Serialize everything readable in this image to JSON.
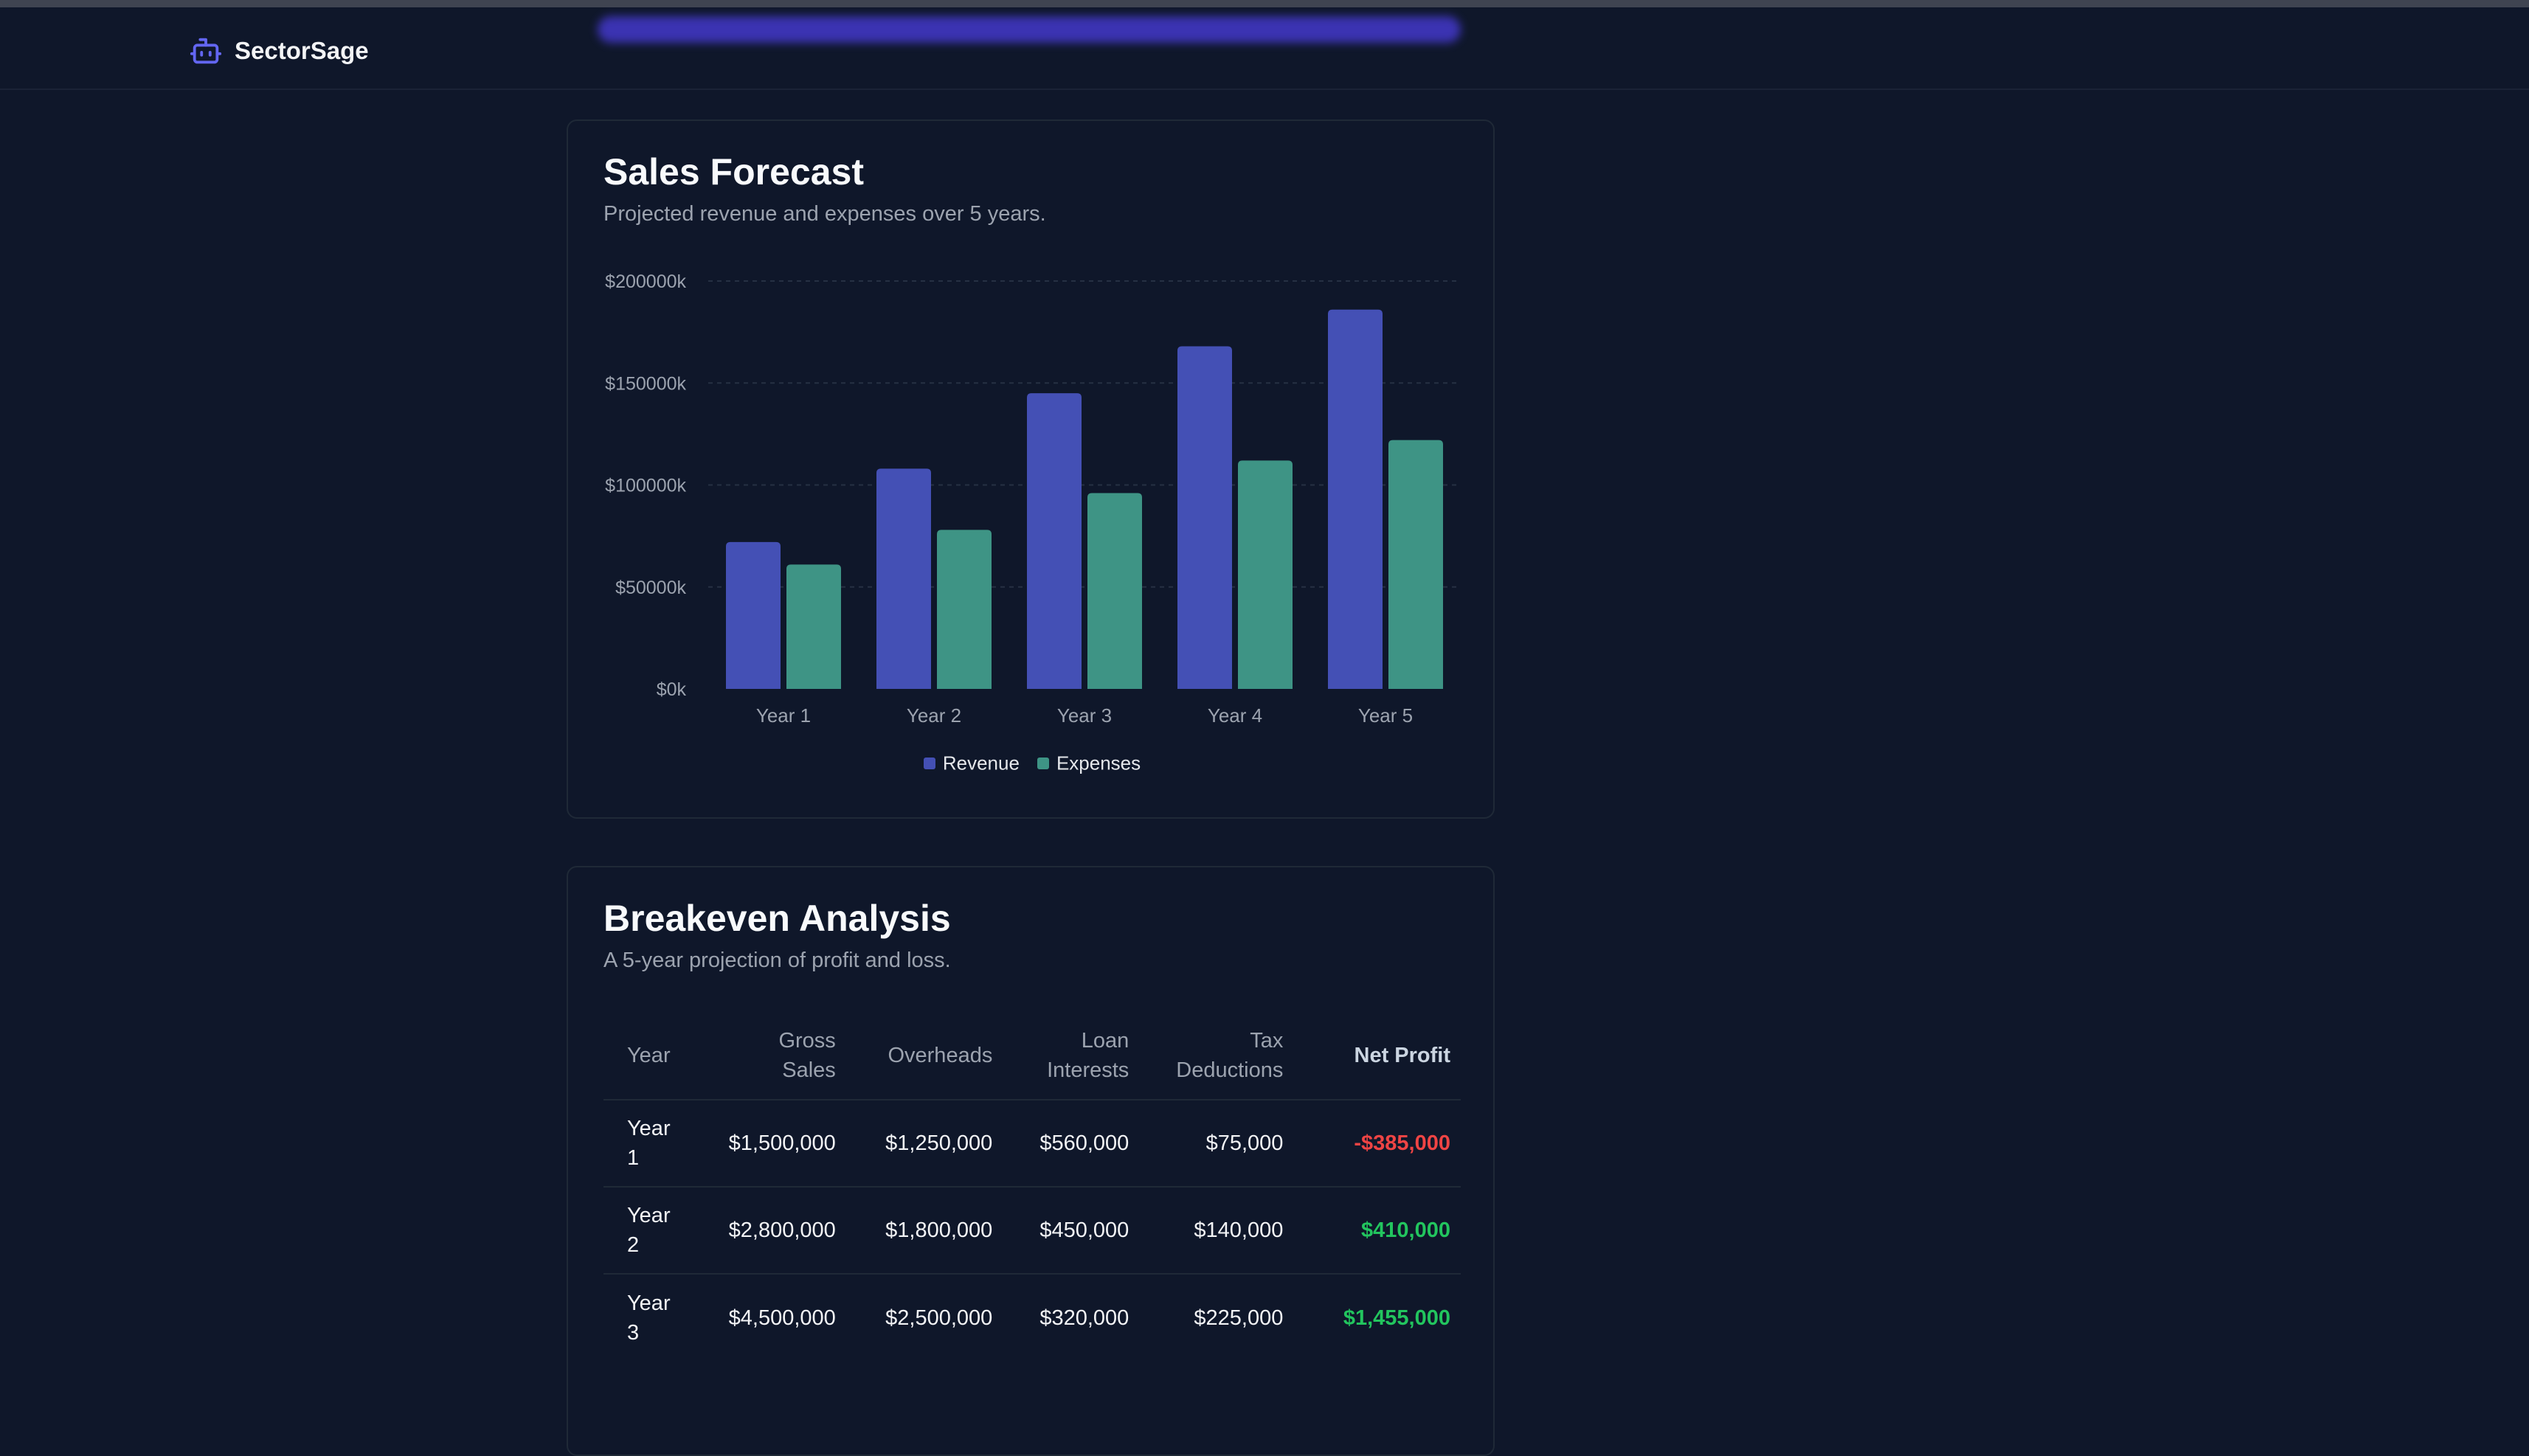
{
  "app": {
    "name": "SectorSage"
  },
  "forecast": {
    "title": "Sales Forecast",
    "subtitle": "Projected revenue and expenses over 5 years."
  },
  "chart_data": {
    "type": "bar",
    "categories": [
      "Year 1",
      "Year 2",
      "Year 3",
      "Year 4",
      "Year 5"
    ],
    "series": [
      {
        "name": "Revenue",
        "values": [
          72000,
          108000,
          145000,
          168000,
          186000
        ],
        "color": "#4450b5"
      },
      {
        "name": "Expenses",
        "values": [
          61000,
          78000,
          96000,
          112000,
          122000
        ],
        "color": "#3e9485"
      }
    ],
    "ylim": [
      0,
      200000
    ],
    "yticks": [
      "$0k",
      "$50000k",
      "$100000k",
      "$150000k",
      "$200000k"
    ],
    "ytick_values": [
      0,
      50000,
      100000,
      150000,
      200000
    ],
    "grid": true,
    "legend": "bottom"
  },
  "breakeven": {
    "title": "Breakeven Analysis",
    "subtitle": "A 5-year projection of profit and loss.",
    "headers": [
      "Year",
      "Gross Sales",
      "Overheads",
      "Loan Interests",
      "Tax Deductions",
      "Net Profit"
    ],
    "rows": [
      [
        "Year 1",
        "$1,500,000",
        "$1,250,000",
        "$560,000",
        "$75,000",
        "-$385,000"
      ],
      [
        "Year 2",
        "$2,800,000",
        "$1,800,000",
        "$450,000",
        "$140,000",
        "$410,000"
      ],
      [
        "Year 3",
        "$4,500,000",
        "$2,500,000",
        "$320,000",
        "$225,000",
        "$1,455,000"
      ]
    ]
  }
}
